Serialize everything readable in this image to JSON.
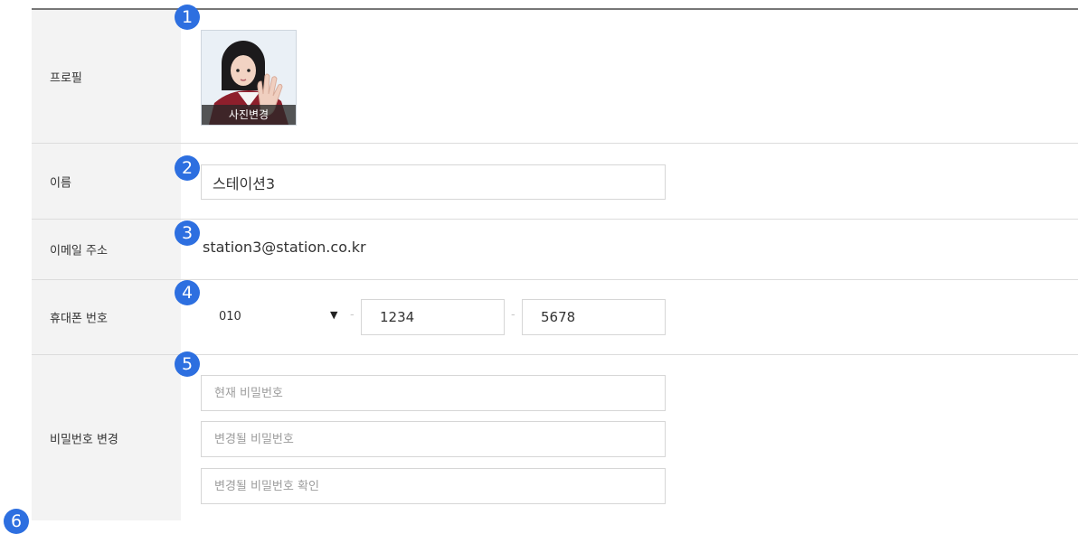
{
  "labels": {
    "profile": "프로필",
    "name": "이름",
    "email": "이메일 주소",
    "phone": "휴대폰 번호",
    "password": "비밀번호 변경"
  },
  "badges": [
    "1",
    "2",
    "3",
    "4",
    "5",
    "6"
  ],
  "profile": {
    "change_photo_label": "사진변경"
  },
  "name_field": {
    "value": "스테이션3"
  },
  "email_value": "station3@station.co.kr",
  "phone": {
    "prefix_selected": "010",
    "middle": "1234",
    "last": "5678",
    "separator": "-"
  },
  "password_fields": {
    "current_placeholder": "현재 비밀번호",
    "new_placeholder": "변경될 비밀번호",
    "confirm_placeholder": "변경될 비밀번호 확인"
  },
  "colors": {
    "badge": "#2d6fe0",
    "label_bg": "#f3f3f3",
    "border": "#d6d6d6"
  },
  "icons": {
    "select_arrow": "dropdown-arrow-icon"
  }
}
